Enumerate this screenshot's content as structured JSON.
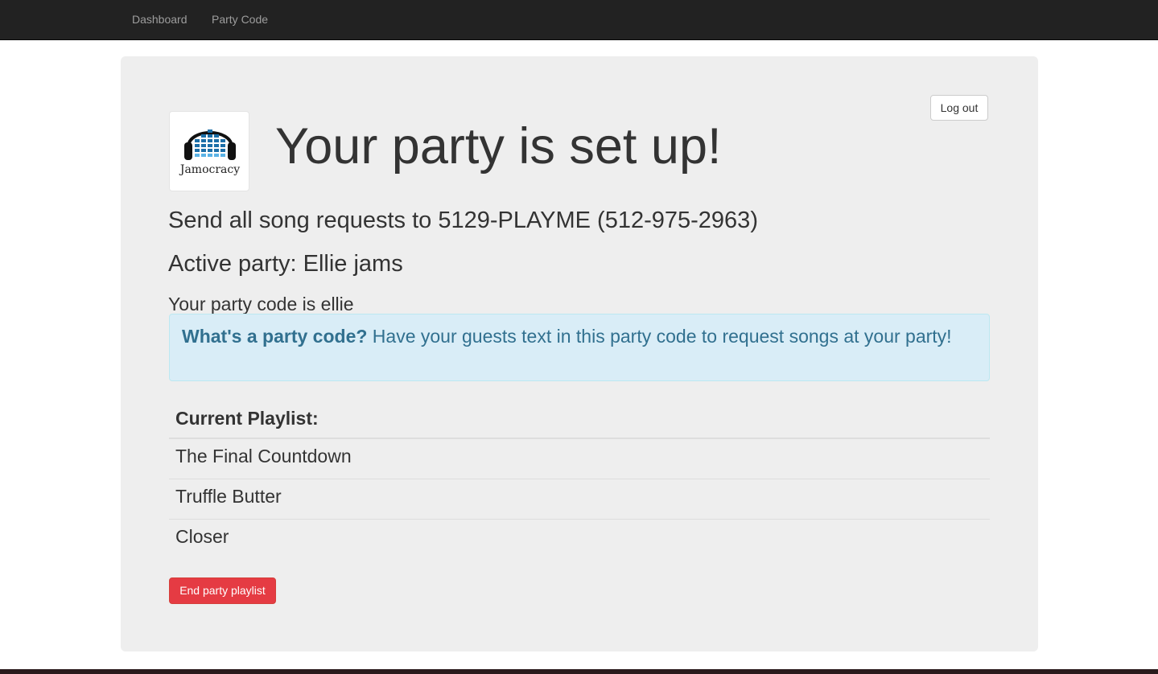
{
  "nav": {
    "items": [
      {
        "label": "Dashboard"
      },
      {
        "label": "Party Code"
      }
    ]
  },
  "header": {
    "logout_label": "Log out",
    "logo_text": "Jamocracy",
    "title": "Your party is set up!"
  },
  "party": {
    "send_requests": "Send all song requests to 5129-PLAYME (512-975-2963)",
    "active_party": "Active party: Ellie jams",
    "code_line": "Your party code is ellie"
  },
  "info": {
    "question": "What's a party code?",
    "answer": " Have your guests text in this party code to request songs at your party!"
  },
  "playlist": {
    "header": "Current Playlist:",
    "songs": [
      "The Final Countdown",
      "Truffle Butter",
      "Closer"
    ]
  },
  "actions": {
    "end_label": "End party playlist"
  },
  "colors": {
    "navbar": "#222222",
    "panel": "#eeeeee",
    "alert_bg": "#d9edf7",
    "alert_text": "#31708f",
    "danger": "#e53b43"
  }
}
